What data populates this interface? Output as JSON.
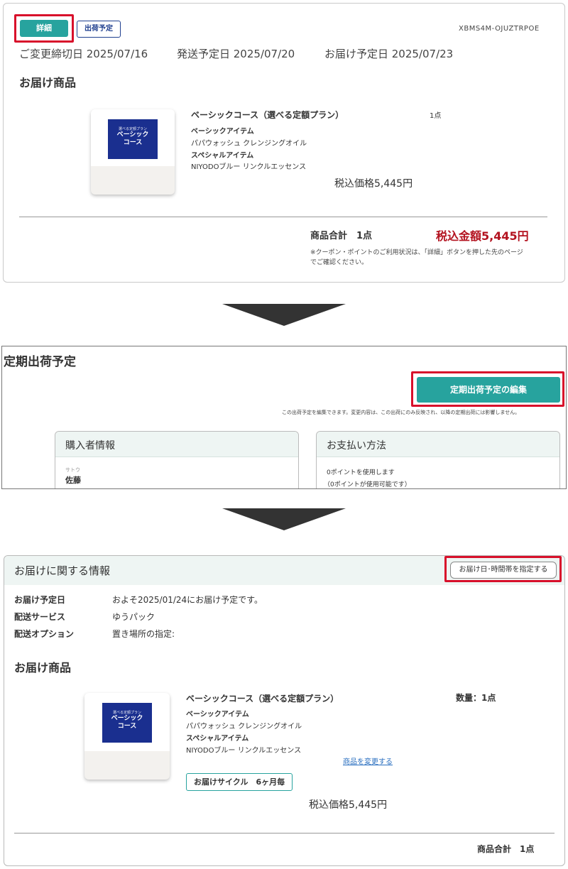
{
  "panel1": {
    "detail_button": "詳細",
    "ship_schedule_button": "出荷予定",
    "order_id": "XBMS4M-OJUZTRPOE",
    "change_deadline": "ご変更締切日 2025/07/16",
    "ship_date": "発送予定日 2025/07/20",
    "delivery_date": "お届け予定日 2025/07/23",
    "section_title": "お届け商品",
    "product": {
      "image_small": "選べる定額プラン",
      "image_line1": "ベーシック",
      "image_line2": "コース",
      "name": "ベーシックコース（選べる定額プラン）",
      "qty": "1点",
      "basic_label": "ベーシックアイテム",
      "basic_item": "パパウォッシュ クレンジングオイル",
      "special_label": "スペシャルアイテム",
      "special_item": "NIYODOブルー リンクルエッセンス",
      "price": "税込価格5,445円"
    },
    "total_label": "商品合計　1点",
    "total_amount": "税込金額5,445円",
    "note": "※クーポン・ポイントのご利用状況は、「詳細」ボタンを押した先のページでご確認ください。",
    "note_line1": "※クーポン・ポイントのご利用状況は、「詳細」ボタンを押した先のページ",
    "note_line2": "でご確認ください。"
  },
  "panel2": {
    "title": "定期出荷予定",
    "edit_button": "定期出荷予定の編集",
    "edit_note": "この出荷予定を編集できます。変更内容は、この出荷にのみ反映され、以降の定期出荷には影響しません。",
    "buyer_card_title": "購入者情報",
    "buyer_kana": "サトウ",
    "buyer_name": "佐藤",
    "payment_card_title": "お支払い方法",
    "points_used": "0ポイントを使用します",
    "points_available": "（0ポイントが使用可能です）"
  },
  "panel3": {
    "title": "お届けに関する情報",
    "date_time_button": "お届け日･時間帯を指定する",
    "rows": [
      {
        "key": "お届け予定日",
        "value": "およそ2025/01/24にお届け予定です。"
      },
      {
        "key": "配送サービス",
        "value": "ゆうパック"
      },
      {
        "key": "配送オプション",
        "value": "置き場所の指定:"
      }
    ],
    "section_title": "お届け商品",
    "product": {
      "image_small": "選べる定額プラン",
      "image_line1": "ベーシック",
      "image_line2": "コース",
      "name": "ベーシックコース（選べる定額プラン）",
      "qty": "数量：1点",
      "basic_label": "ベーシックアイテム",
      "basic_item": "パパウォッシュ クレンジングオイル",
      "special_label": "スペシャルアイテム",
      "special_item": "NIYODOブルー リンクルエッセンス",
      "change_link": "商品を変更する",
      "cycle_badge": "お届けサイクル　6ヶ月毎",
      "price": "税込価格5,445円"
    },
    "total_label": "商品合計　1点"
  },
  "colors": {
    "teal": "#27a39e",
    "highlight_red": "#d8102b",
    "price_red": "#b3121f",
    "navy": "#1a2f8f",
    "header_tint": "#eef5f3"
  }
}
